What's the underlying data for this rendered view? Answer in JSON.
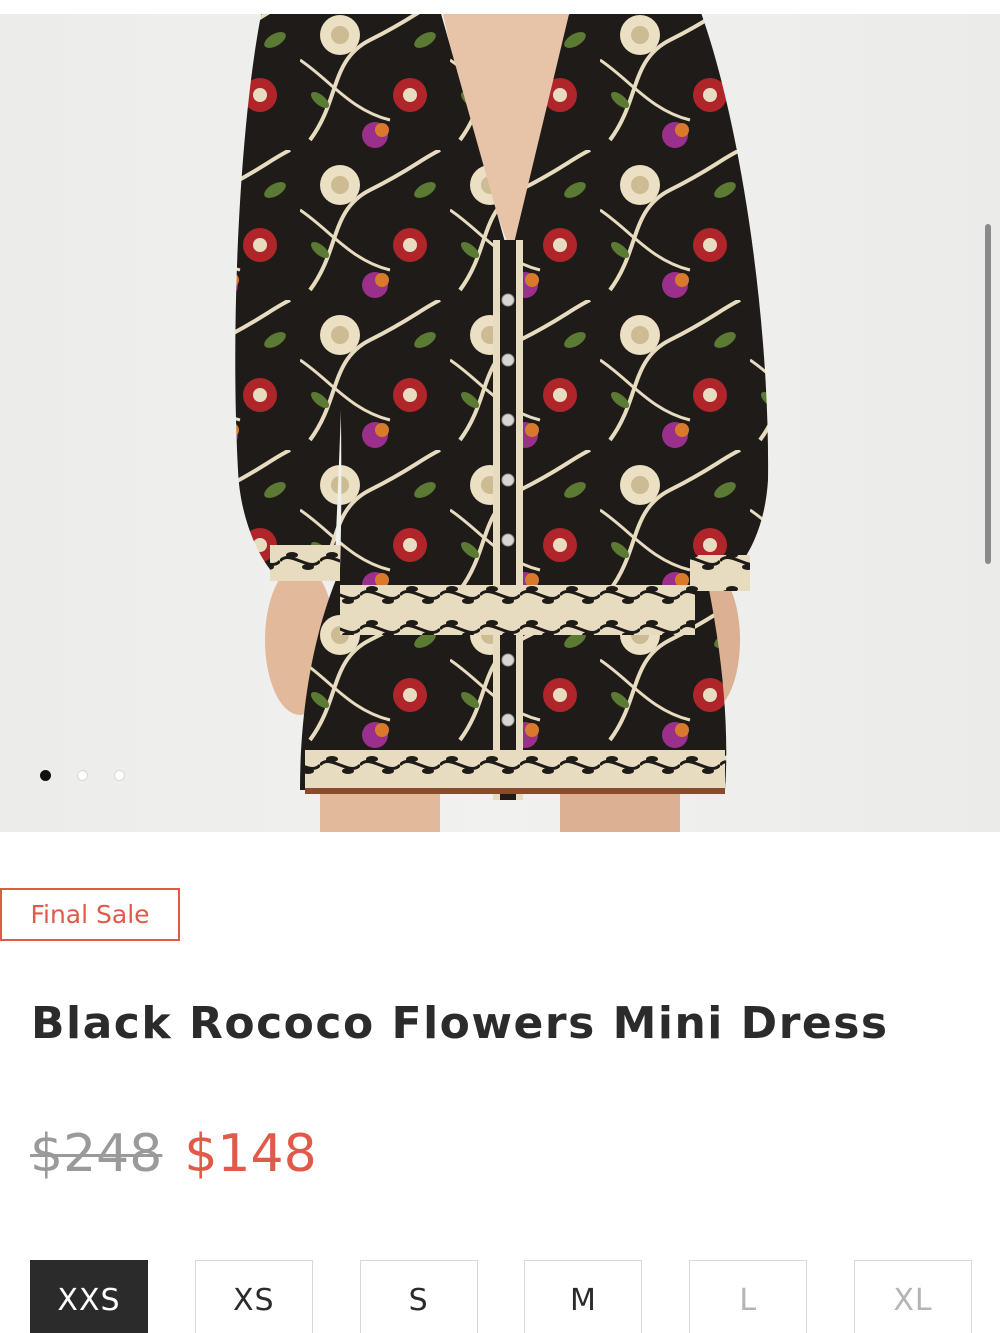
{
  "product": {
    "badge": "Final Sale",
    "title": "Black Rococo Flowers Mini Dress",
    "price_original": "$248",
    "price_sale": "$148",
    "image_description_icon": "dress-photo"
  },
  "gallery": {
    "slide_count": 3,
    "active_slide": 1
  },
  "sizes": [
    {
      "label": "XXS",
      "state": "selected"
    },
    {
      "label": "XS",
      "state": "available"
    },
    {
      "label": "S",
      "state": "available"
    },
    {
      "label": "M",
      "state": "available"
    },
    {
      "label": "L",
      "state": "unavailable"
    },
    {
      "label": "XL",
      "state": "unavailable"
    }
  ],
  "colors": {
    "accent": "#e05a4a",
    "selected_size_bg": "#2b2b2b",
    "dress_base": "#1e1b18"
  }
}
